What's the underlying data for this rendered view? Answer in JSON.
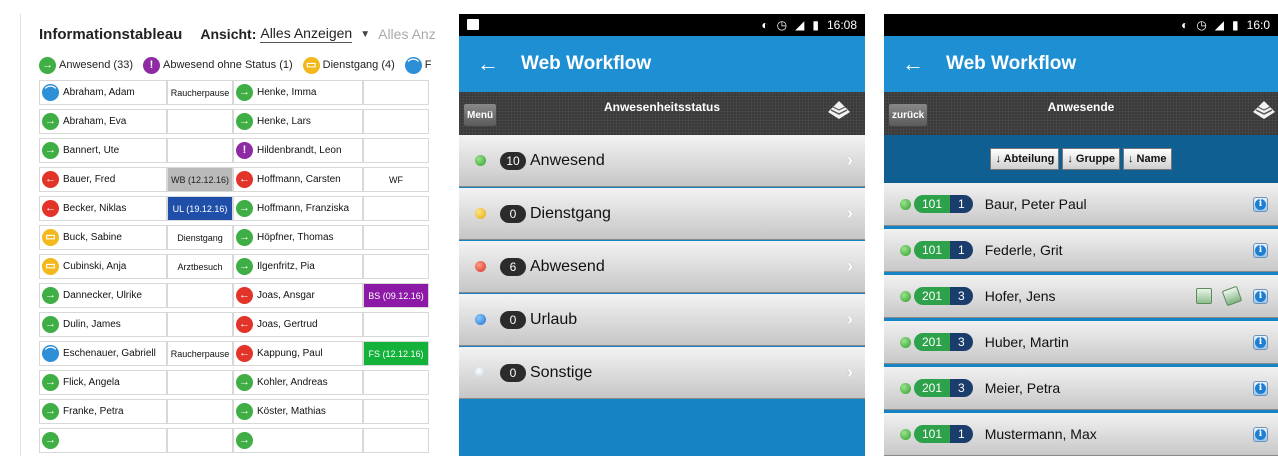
{
  "tableau": {
    "title": "Informationstableau",
    "view_label": "Ansicht:",
    "view_value": "Alles Anzeigen",
    "view_next": "Alles Anz",
    "legend": [
      {
        "label": "Anwesend (33)",
        "color": "green",
        "glyph": "→"
      },
      {
        "label": "Abwesend ohne Status (1)",
        "color": "purple",
        "glyph": "!"
      },
      {
        "label": "Dienstgang (4)",
        "color": "yellow",
        "glyph": "▭"
      },
      {
        "label": "F",
        "color": "blue",
        "glyph": "⌒"
      }
    ],
    "rows": [
      {
        "left": {
          "name": "Abraham, Adam",
          "color": "blue",
          "glyph": "⌒",
          "note": "Raucherpause",
          "note_style": ""
        },
        "right": {
          "name": "Henke, Imma",
          "color": "green",
          "glyph": "→",
          "note": "",
          "note_style": ""
        }
      },
      {
        "left": {
          "name": "Abraham, Eva",
          "color": "green",
          "glyph": "→",
          "note": "",
          "note_style": ""
        },
        "right": {
          "name": "Henke, Lars",
          "color": "green",
          "glyph": "→",
          "note": "",
          "note_style": ""
        }
      },
      {
        "left": {
          "name": "Bannert, Ute",
          "color": "green",
          "glyph": "→",
          "note": "",
          "note_style": ""
        },
        "right": {
          "name": "Hildenbrandt, Leon",
          "color": "purple",
          "glyph": "!",
          "note": "",
          "note_style": ""
        }
      },
      {
        "left": {
          "name": "Bauer, Fred",
          "color": "red",
          "glyph": "←",
          "note": "WB (12.12.16)",
          "note_style": "grey"
        },
        "right": {
          "name": "Hoffmann, Carsten",
          "color": "red",
          "glyph": "←",
          "note": "WF",
          "note_style": ""
        }
      },
      {
        "left": {
          "name": "Becker, Niklas",
          "color": "red",
          "glyph": "←",
          "note": "UL (19.12.16)",
          "note_style": "blue"
        },
        "right": {
          "name": "Hoffmann, Franziska",
          "color": "green",
          "glyph": "→",
          "note": "",
          "note_style": ""
        }
      },
      {
        "left": {
          "name": "Buck, Sabine",
          "color": "yellow",
          "glyph": "▭",
          "note": "Dienstgang",
          "note_style": ""
        },
        "right": {
          "name": "Höpfner, Thomas",
          "color": "green",
          "glyph": "→",
          "note": "",
          "note_style": ""
        }
      },
      {
        "left": {
          "name": "Cubinski, Anja",
          "color": "yellow",
          "glyph": "▭",
          "note": "Arztbesuch",
          "note_style": ""
        },
        "right": {
          "name": "Ilgenfritz, Pia",
          "color": "green",
          "glyph": "→",
          "note": "",
          "note_style": ""
        }
      },
      {
        "left": {
          "name": "Dannecker, Ulrike",
          "color": "green",
          "glyph": "→",
          "note": "",
          "note_style": ""
        },
        "right": {
          "name": "Joas, Ansgar",
          "color": "red",
          "glyph": "←",
          "note": "BS (09.12.16)",
          "note_style": "purple"
        }
      },
      {
        "left": {
          "name": "Dulin, James",
          "color": "green",
          "glyph": "→",
          "note": "",
          "note_style": ""
        },
        "right": {
          "name": "Joas, Gertrud",
          "color": "red",
          "glyph": "←",
          "note": "",
          "note_style": ""
        }
      },
      {
        "left": {
          "name": "Eschenauer, Gabriell",
          "color": "blue",
          "glyph": "⌒",
          "note": "Raucherpause",
          "note_style": ""
        },
        "right": {
          "name": "Kappung, Paul",
          "color": "red",
          "glyph": "←",
          "note": "FS (12.12.16)",
          "note_style": "green"
        }
      },
      {
        "left": {
          "name": "Flick, Angela",
          "color": "green",
          "glyph": "→",
          "note": "",
          "note_style": ""
        },
        "right": {
          "name": "Kohler, Andreas",
          "color": "green",
          "glyph": "→",
          "note": "",
          "note_style": ""
        }
      },
      {
        "left": {
          "name": "Franke, Petra",
          "color": "green",
          "glyph": "→",
          "note": "",
          "note_style": ""
        },
        "right": {
          "name": "Köster, Mathias",
          "color": "green",
          "glyph": "→",
          "note": "",
          "note_style": ""
        }
      },
      {
        "left": {
          "name": "",
          "color": "green",
          "glyph": "→",
          "note": "",
          "note_style": ""
        },
        "right": {
          "name": "",
          "color": "green",
          "glyph": "→",
          "note": "",
          "note_style": ""
        }
      }
    ]
  },
  "phone1": {
    "time": "16:08",
    "app_title": "Web Workflow",
    "back_icon": "←",
    "menu_button": "Menü",
    "toolbar_title": "Anwesenheitsstatus",
    "statuses": [
      {
        "count": "10",
        "label": "Anwesend",
        "dot": "green"
      },
      {
        "count": "0",
        "label": "Dienstgang",
        "dot": "yellow"
      },
      {
        "count": "6",
        "label": "Abwesend",
        "dot": "red"
      },
      {
        "count": "0",
        "label": "Urlaub",
        "dot": "blue"
      },
      {
        "count": "0",
        "label": "Sonstige",
        "dot": "white"
      }
    ]
  },
  "phone2": {
    "time": "16:0",
    "app_title": "Web Workflow",
    "back_icon": "←",
    "back_button": "zurück",
    "toolbar_title": "Anwesende",
    "sort_buttons": [
      "↓ Abteilung",
      "↓ Gruppe",
      "↓ Name"
    ],
    "people": [
      {
        "dept": "101",
        "group": "1",
        "name": "Baur, Peter Paul",
        "extra_icons": false
      },
      {
        "dept": "101",
        "group": "1",
        "name": "Federle, Grit",
        "extra_icons": false
      },
      {
        "dept": "201",
        "group": "3",
        "name": "Hofer, Jens",
        "extra_icons": true
      },
      {
        "dept": "201",
        "group": "3",
        "name": "Huber, Martin",
        "extra_icons": false
      },
      {
        "dept": "201",
        "group": "3",
        "name": "Meier, Petra",
        "extra_icons": false
      },
      {
        "dept": "101",
        "group": "1",
        "name": "Mustermann, Max",
        "extra_icons": false
      }
    ]
  },
  "colors": {
    "green": "#3fae45",
    "red": "#e3342a",
    "yellow": "#f2b81c",
    "blue": "#2d8fd6",
    "purple": "#8e2aa3",
    "appbar": "#1e8fd2",
    "page_blue": "#1683c4"
  }
}
